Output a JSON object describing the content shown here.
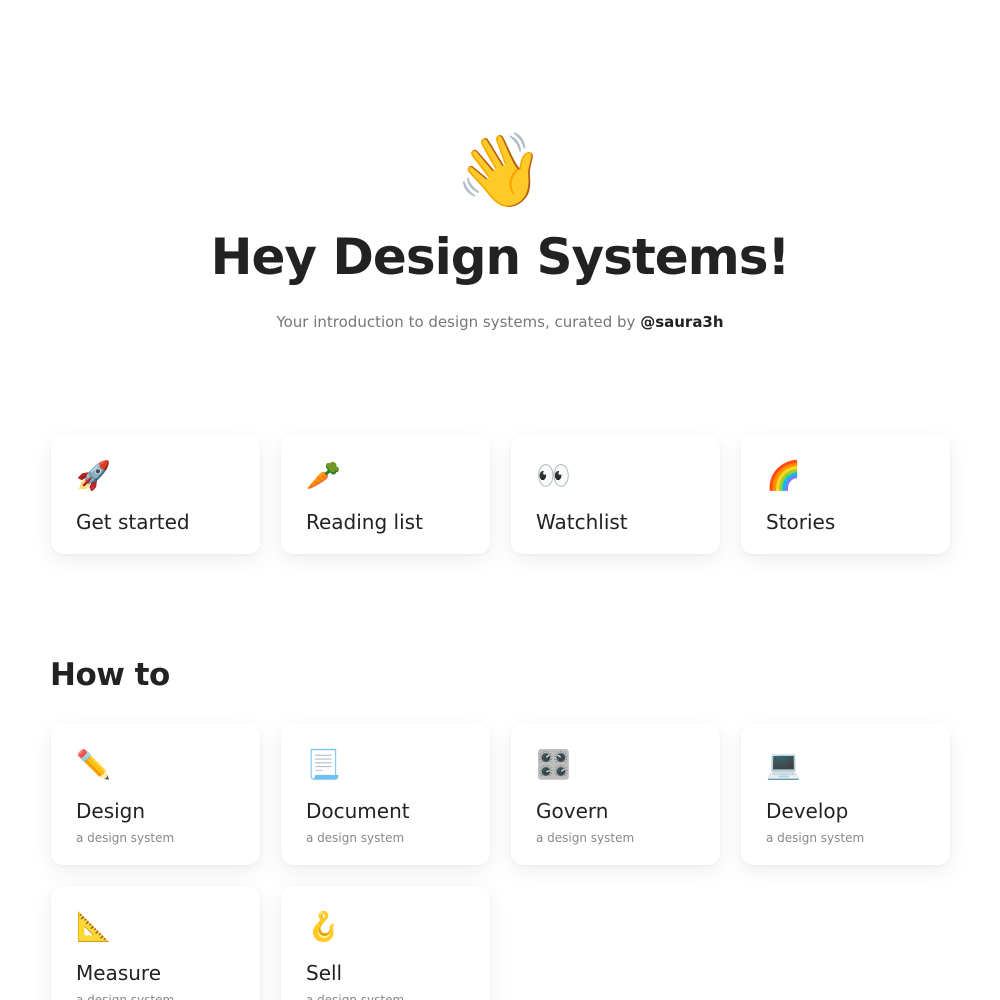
{
  "hero": {
    "emoji": "👋",
    "icon_name": "waving-hand-icon",
    "title": "Hey Design Systems!",
    "subtitle_prefix": "Your introduction to design systems, curated by ",
    "subtitle_handle": "@saura3h"
  },
  "top_cards": [
    {
      "icon": "🚀",
      "icon_name": "rocket-icon",
      "title": "Get started"
    },
    {
      "icon": "🥕",
      "icon_name": "carrot-icon",
      "title": "Reading list"
    },
    {
      "icon": "👀",
      "icon_name": "eyes-icon",
      "title": "Watchlist"
    },
    {
      "icon": "🌈",
      "icon_name": "rainbow-icon",
      "title": "Stories"
    }
  ],
  "howto": {
    "title": "How to",
    "cards": [
      {
        "icon": "✏️",
        "icon_name": "pencil-icon",
        "title": "Design",
        "subtitle": "a design system"
      },
      {
        "icon": "📃",
        "icon_name": "page-curl-icon",
        "title": "Document",
        "subtitle": "a design system"
      },
      {
        "icon": "🎛️",
        "icon_name": "control-knobs-icon",
        "title": "Govern",
        "subtitle": "a design system"
      },
      {
        "icon": "💻",
        "icon_name": "laptop-icon",
        "title": "Develop",
        "subtitle": "a design system"
      },
      {
        "icon": "📐",
        "icon_name": "triangular-ruler-icon",
        "title": "Measure",
        "subtitle": "a design system"
      },
      {
        "icon": "🪝",
        "icon_name": "hook-icon",
        "title": "Sell",
        "subtitle": "a design system"
      }
    ]
  }
}
